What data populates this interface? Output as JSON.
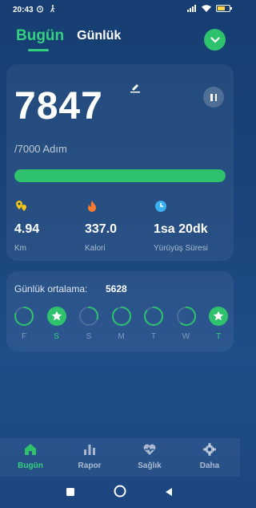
{
  "status": {
    "time": "20:43",
    "battery": "62"
  },
  "tabs": {
    "today": "Bugün",
    "daily": "Günlük"
  },
  "summary": {
    "steps": "7847",
    "goal": "/7000 Adım",
    "progress_fraction": 1.0,
    "stats": [
      {
        "icon": "location-pin-icon",
        "value": "4.94",
        "label": "Km"
      },
      {
        "icon": "fire-icon",
        "value": "337.0",
        "label": "Kalori"
      },
      {
        "icon": "clock-icon",
        "value": "1sa 20dk",
        "label": "Yürüyüş Süresi"
      }
    ]
  },
  "week": {
    "average_label": "Günlük ortalama:",
    "average_value": "5628",
    "days": [
      {
        "label": "F",
        "progress": 0.8,
        "achieved": false
      },
      {
        "label": "S",
        "progress": 1.0,
        "achieved": true
      },
      {
        "label": "S",
        "progress": 0.3,
        "achieved": false
      },
      {
        "label": "M",
        "progress": 0.9,
        "achieved": false
      },
      {
        "label": "T",
        "progress": 0.85,
        "achieved": false
      },
      {
        "label": "W",
        "progress": 0.6,
        "achieved": false
      },
      {
        "label": "T",
        "progress": 1.0,
        "achieved": true
      }
    ]
  },
  "nav": [
    {
      "label": "Bugün",
      "icon": "home-icon",
      "active": true
    },
    {
      "label": "Rapor",
      "icon": "bar-chart-icon",
      "active": false
    },
    {
      "label": "Sağlık",
      "icon": "heart-pulse-icon",
      "active": false
    },
    {
      "label": "Daha",
      "icon": "gear-icon",
      "active": false
    }
  ],
  "colors": {
    "accent": "#2ec26d",
    "background": "#1a447a"
  }
}
